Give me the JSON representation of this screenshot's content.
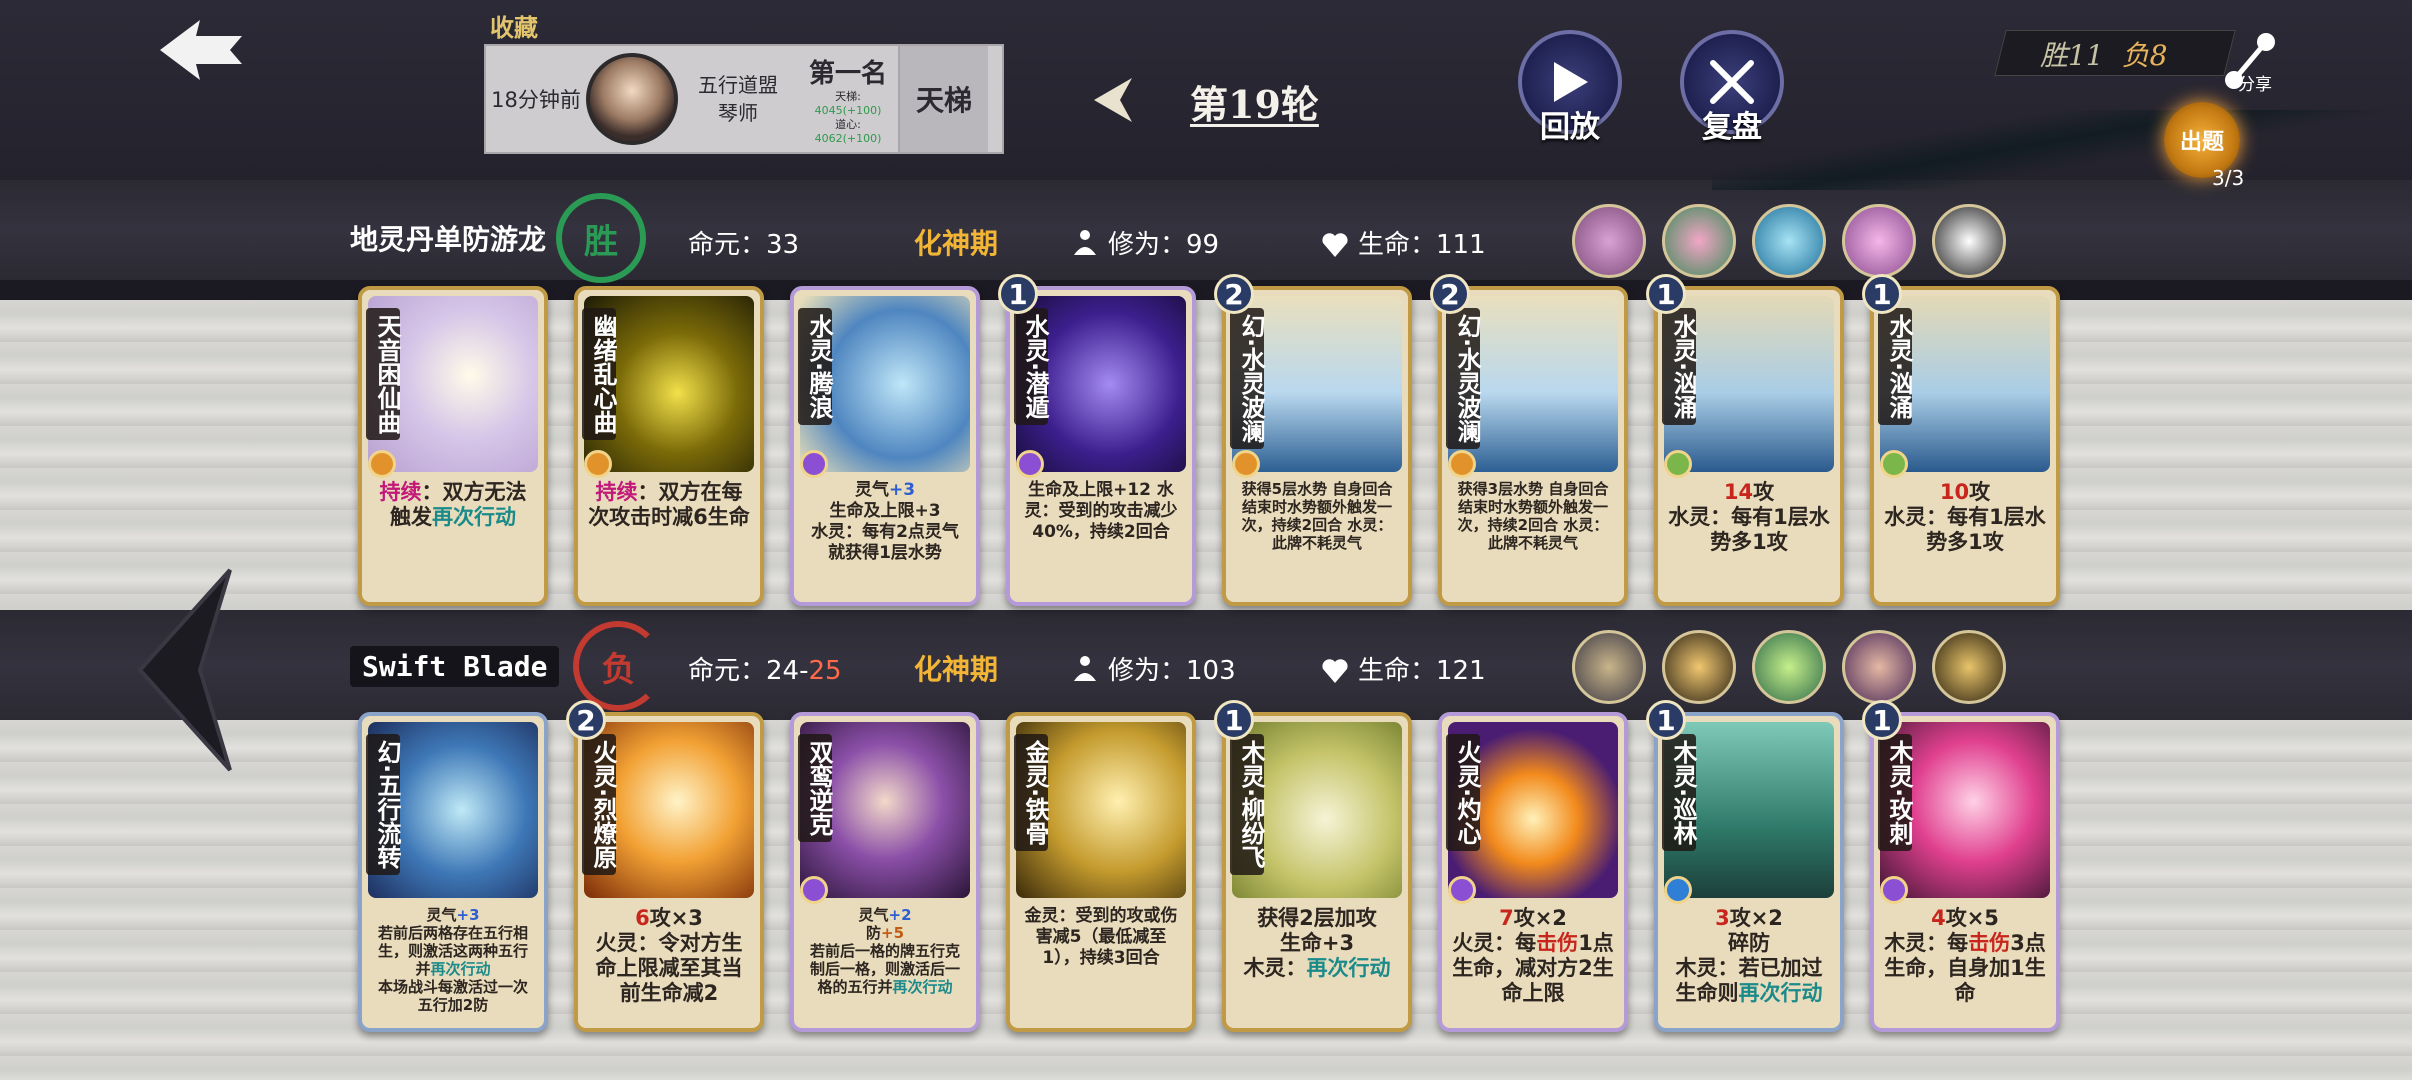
{
  "header": {
    "favorites_label": "收藏",
    "record": {
      "time": "18分钟前",
      "name_line1": "五行道盟",
      "name_line2": "琴师",
      "rank": "第一名",
      "rank_detail1": "天梯:",
      "rank_detail2": "4045(+100)",
      "rank_detail3": "道心:",
      "rank_detail4": "4062(+100)",
      "mode": "天梯"
    },
    "round": "第19轮",
    "replay_label": "回放",
    "review_label": "复盘",
    "wins": "胜11",
    "losses": "负8",
    "share_label": "分享",
    "quest_label": "出题",
    "quest_count": "3/3"
  },
  "player1": {
    "name": "地灵丹单防游龙",
    "result": "胜",
    "life_origin_label": "命元：",
    "life_origin": "33",
    "realm": "化神期",
    "cultivation_label": "修为：",
    "cultivation": "99",
    "health_label": "生命：",
    "health": "111",
    "cards": [
      {
        "name": "天音困仙曲",
        "level": "",
        "desc": "持续：双方无法触发再次行动",
        "style": "gold"
      },
      {
        "name": "幽绪乱心曲",
        "level": "",
        "desc": "持续：双方在每次攻击时减6生命",
        "style": "gold"
      },
      {
        "name": "水灵·腾浪",
        "level": "",
        "desc": "灵气+3 生命及上限+3 水灵：每有2点灵气就获得1层水势",
        "style": "purple"
      },
      {
        "name": "水灵·潜遁",
        "level": "1",
        "desc": "生命及上限+12 水灵：受到的攻击减少40%，持续2回合",
        "style": "purple"
      },
      {
        "name": "幻·水灵波澜",
        "level": "2",
        "desc": "获得5层水势 自身回合结束时水势额外触发一次，持续2回合 水灵：此牌不耗灵气",
        "style": "gold"
      },
      {
        "name": "幻·水灵波澜",
        "level": "2",
        "desc": "获得3层水势 自身回合结束时水势额外触发一次，持续2回合 水灵：此牌不耗灵气",
        "style": "gold"
      },
      {
        "name": "水灵·汹涌",
        "level": "1",
        "desc": "14攻 水灵：每有1层水势多1攻",
        "style": "gold"
      },
      {
        "name": "水灵·汹涌",
        "level": "1",
        "desc": "10攻 水灵：每有1层水势多1攻",
        "style": "gold"
      }
    ]
  },
  "player2": {
    "name": "Swift Blade",
    "result": "负",
    "life_origin_label": "命元：",
    "life_origin": "24-",
    "life_origin_red": "25",
    "realm": "化神期",
    "cultivation_label": "修为：",
    "cultivation": "103",
    "health_label": "生命：",
    "health": "121",
    "cards": [
      {
        "name": "幻·五行流转",
        "level": "",
        "desc": "灵气+3 若前后两格存在五行相生，则激活这两种五行并再次行动 本场战斗每激活过一次五行加2防",
        "style": "blue"
      },
      {
        "name": "火灵·烈燎原",
        "level": "2",
        "desc": "6攻×3 火灵：令对方生命上限减至其当前生命减2",
        "style": "gold"
      },
      {
        "name": "双鸾逆克",
        "level": "",
        "desc": "灵气+2 防+5 若前后一格的牌五行克制后一格，则激活后一格的五行并再次行动",
        "style": "purple"
      },
      {
        "name": "金灵·铁骨",
        "level": "",
        "desc": "金灵：受到的攻或伤害减5（最低减至1），持续3回合",
        "style": "gold"
      },
      {
        "name": "木灵·柳纷飞",
        "level": "1",
        "desc": "获得2层加攻 生命+3 木灵：再次行动",
        "style": "gold"
      },
      {
        "name": "火灵·灼心",
        "level": "",
        "desc": "7攻×2 火灵：每击伤1点生命，减对方2生命上限",
        "style": "purple"
      },
      {
        "name": "木灵·巡林",
        "level": "1",
        "desc": "3攻×2 碎防 木灵：若已加过生命则再次行动",
        "style": "blue"
      },
      {
        "name": "木灵·玫刺",
        "level": "1",
        "desc": "4攻×5 木灵：每击伤3点生命，自身加1生命",
        "style": "purple"
      }
    ]
  },
  "colors": {
    "gold": "#e2c46c",
    "realm": "#f2b535",
    "win": "#2b9a55",
    "loss": "#c33a30"
  },
  "icons": {
    "back": "back-arrow-icon",
    "replay": "play-icon",
    "review": "crossed-swords-icon",
    "share": "share-icon",
    "cultivation": "meditation-icon",
    "health": "heart-drop-icon"
  }
}
